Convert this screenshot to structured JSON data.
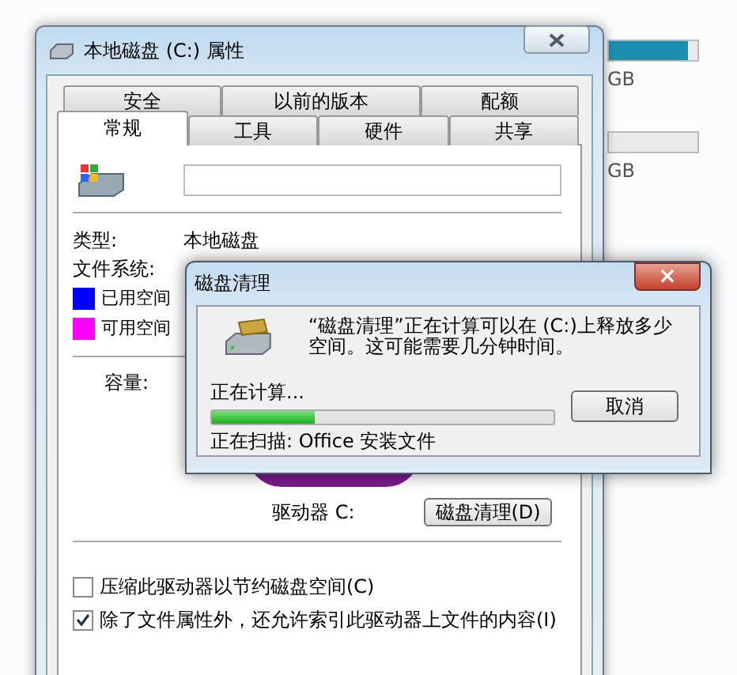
{
  "background": {
    "drives": [
      {
        "size_text": "GB",
        "level": 0.9
      },
      {
        "size_text": "GB"
      }
    ]
  },
  "properties": {
    "title": "本地磁盘 (C:) 属性",
    "tab_rows": [
      [
        {
          "label": "安全",
          "selected": false
        },
        {
          "label": "以前的版本",
          "selected": false
        },
        {
          "label": "配额",
          "selected": false
        }
      ],
      [
        {
          "label": "常规",
          "selected": true
        },
        {
          "label": "工具",
          "selected": false
        },
        {
          "label": "硬件",
          "selected": false
        },
        {
          "label": "共享",
          "selected": false
        }
      ]
    ],
    "type_label": "类型:",
    "type_value": "本地磁盘",
    "fs_label": "文件系统:",
    "legend": [
      {
        "label": "已用空间",
        "color": "#0000ff"
      },
      {
        "label": "可用空间",
        "color": "#ff00ff"
      }
    ],
    "capacity_label": "容量:",
    "drive_label": "驱动器 C:",
    "cleanup_button": "磁盘清理(D)",
    "options": [
      {
        "label": "压缩此驱动器以节约磁盘空间(C)",
        "checked": false
      },
      {
        "label": "除了文件属性外，还允许索引此驱动器上文件的内容(I)",
        "checked": true
      }
    ]
  },
  "cleanup": {
    "title": "磁盘清理",
    "close": "×",
    "message": "“磁盘清理”正在计算可以在 (C:)上释放多少空间。这可能需要几分钟时间。",
    "status": "正在计算...",
    "level": 0.3,
    "cancel_button": "取消",
    "scanning": "正在扫描: Office 安装文件"
  }
}
